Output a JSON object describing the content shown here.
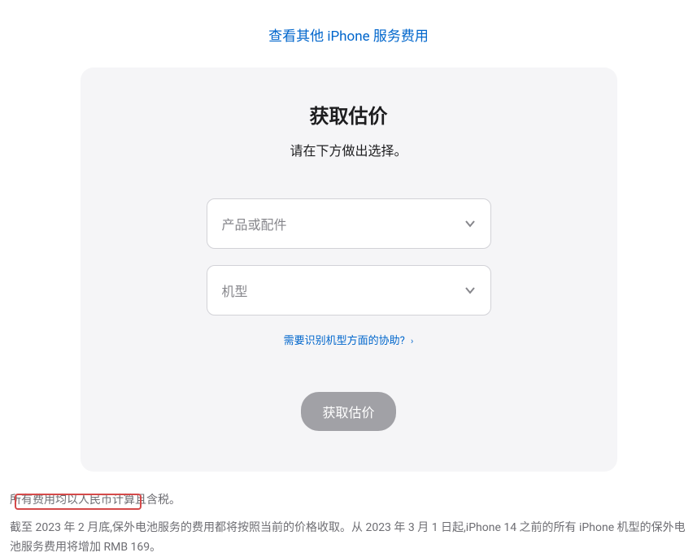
{
  "topLink": "查看其他 iPhone 服务费用",
  "card": {
    "title": "获取估价",
    "subtitle": "请在下方做出选择。",
    "select1": "产品或配件",
    "select2": "机型",
    "helpLink": "需要识别机型方面的协助?",
    "button": "获取估价"
  },
  "footer": {
    "line1": "所有费用均以人民币计算且含税。",
    "line2": "截至 2023 年 2 月底,保外电池服务的费用都将按照当前的价格收取。从 2023 年 3 月 1 日起,iPhone 14 之前的所有 iPhone 机型的保外电池服务费用将增加 RMB 169。"
  }
}
